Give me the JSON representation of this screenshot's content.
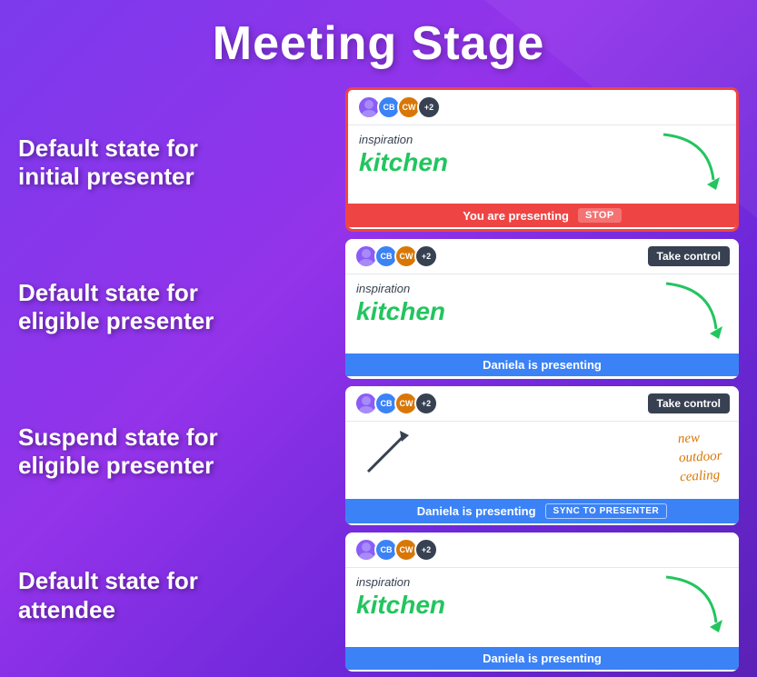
{
  "page": {
    "title": "Meeting Stage",
    "background_colors": [
      "#7c3aed",
      "#9333ea",
      "#6d28d9"
    ]
  },
  "states": [
    {
      "id": "initial-presenter",
      "label": "Default state for\ninitial presenter",
      "panel": {
        "border": "red",
        "has_take_control": false,
        "content_type": "inspiration-kitchen",
        "footer_type": "you-are-presenting",
        "footer_text": "You are presenting",
        "stop_label": "STOP"
      }
    },
    {
      "id": "eligible-presenter",
      "label": "Default state for\neligible presenter",
      "panel": {
        "border": "none",
        "has_take_control": true,
        "take_control_label": "Take control",
        "content_type": "inspiration-kitchen",
        "footer_type": "daniela-presenting",
        "footer_text": "Daniela is presenting"
      }
    },
    {
      "id": "suspend-eligible",
      "label": "Suspend state for\neligible presenter",
      "panel": {
        "border": "none",
        "has_take_control": true,
        "take_control_label": "Take control",
        "content_type": "suspend",
        "footer_type": "daniela-sync",
        "footer_text": "Daniela is presenting",
        "sync_label": "SYNC TO PRESENTER"
      }
    },
    {
      "id": "attendee",
      "label": "Default state for\nattendee",
      "panel": {
        "border": "none",
        "has_take_control": false,
        "content_type": "inspiration-kitchen",
        "footer_type": "daniela-presenting",
        "footer_text": "Daniela is presenting"
      }
    }
  ],
  "avatars": {
    "count_label": "+2"
  },
  "handwriting": {
    "inspiration": "inspiration",
    "kitchen": "kitchen",
    "new_outdoor_ceiling": "new\noutdoor\ncealing"
  }
}
